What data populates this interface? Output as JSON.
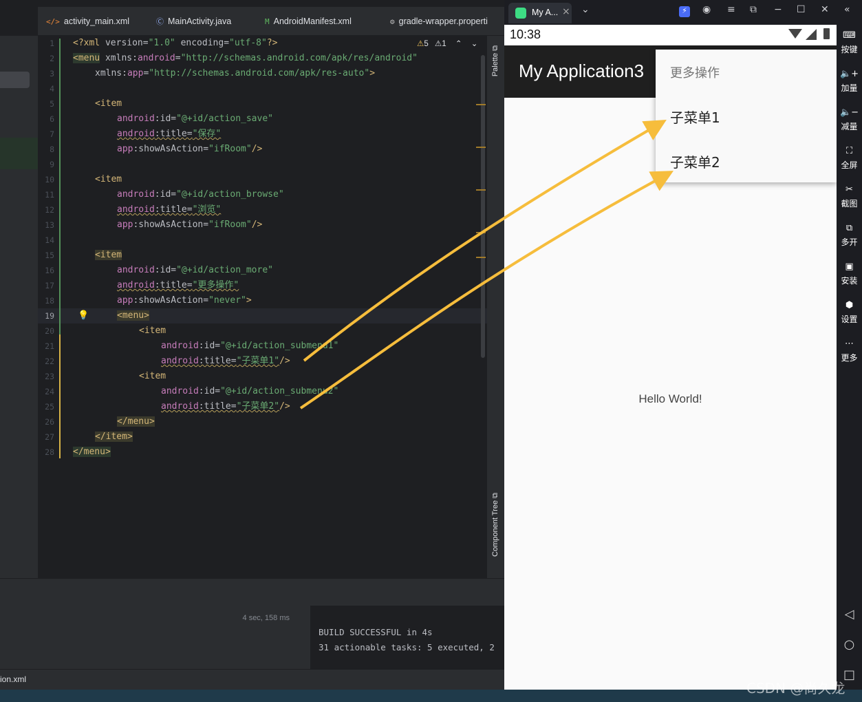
{
  "tabs": [
    {
      "icon": "</>",
      "label": "activity_main.xml"
    },
    {
      "icon": "C",
      "label": "MainActivity.java"
    },
    {
      "icon": "M",
      "label": "AndroidManifest.xml"
    },
    {
      "icon": "⚙",
      "label": "gradle-wrapper.properti"
    }
  ],
  "inspections": {
    "warnings": "5",
    "weak_warnings": "1"
  },
  "palette_label": "Palette",
  "component_tree_label": "Component Tree",
  "line_numbers": [
    "1",
    "2",
    "3",
    "4",
    "5",
    "6",
    "7",
    "8",
    "9",
    "10",
    "11",
    "12",
    "13",
    "14",
    "15",
    "16",
    "17",
    "18",
    "19",
    "20",
    "21",
    "22",
    "23",
    "24",
    "25",
    "26",
    "27",
    "28"
  ],
  "current_line": "19",
  "build": {
    "timing": "4 sec, 158 ms",
    "line1": "BUILD SUCCESSFUL in 4s",
    "line2": "31 actionable tasks: 5 executed, 2"
  },
  "status_file": "ion.xml",
  "emulator": {
    "tab_title": "My A...",
    "clock": "10:38",
    "app_title": "My Application3",
    "hello": "Hello World!",
    "menu_header": "更多操作",
    "menu_items": [
      "子菜单1",
      "子菜单2"
    ],
    "side_buttons": [
      {
        "icon": "keyboard-icon",
        "label": "按键"
      },
      {
        "icon": "volume-up-icon",
        "label": "加量"
      },
      {
        "icon": "volume-down-icon",
        "label": "减量"
      },
      {
        "icon": "fullscreen-icon",
        "label": "全屏"
      },
      {
        "icon": "scissors-icon",
        "label": "截图"
      },
      {
        "icon": "multi-open-icon",
        "label": "多开"
      },
      {
        "icon": "apk-icon",
        "label": "安装"
      },
      {
        "icon": "settings-icon",
        "label": "设置"
      },
      {
        "icon": "more-icon",
        "label": "更多"
      }
    ]
  },
  "watermark": "CSDN @尚久龙",
  "colors": {
    "arrow": "#f6bd3c",
    "tag": "#d5b778",
    "attr": "#c77dbb",
    "string": "#6aab73"
  }
}
